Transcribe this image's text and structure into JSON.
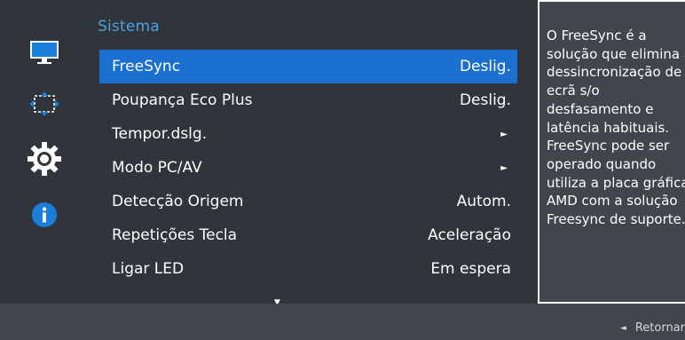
{
  "sidebar": {
    "icons": [
      "monitor-icon",
      "resize-arrows-icon",
      "gear-icon",
      "info-icon"
    ],
    "accent_color": "#1a6fcf"
  },
  "menu": {
    "title": "Sistema",
    "items": [
      {
        "label": "FreeSync",
        "value": "Deslig.",
        "selected": true
      },
      {
        "label": "Poupança Eco Plus",
        "value": "Deslig."
      },
      {
        "label": "Tempor.dslg.",
        "value": "►"
      },
      {
        "label": "Modo PC/AV",
        "value": "►"
      },
      {
        "label": "Detecção Origem",
        "value": "Autom."
      },
      {
        "label": "Repetições Tecla",
        "value": "Aceleração"
      },
      {
        "label": "Ligar LED",
        "value": "Em espera"
      }
    ],
    "more_indicator": "▼"
  },
  "description": {
    "text": "O FreeSync é a solução que elimina a dessincronização de ecrã s/o desfasamento e latência habituais. FreeSync pode ser operado quando utiliza a placa gráfica AMD com a solução Freesync de suporte."
  },
  "footer": {
    "return_arrow": "◄",
    "return_label": "Retornar"
  }
}
